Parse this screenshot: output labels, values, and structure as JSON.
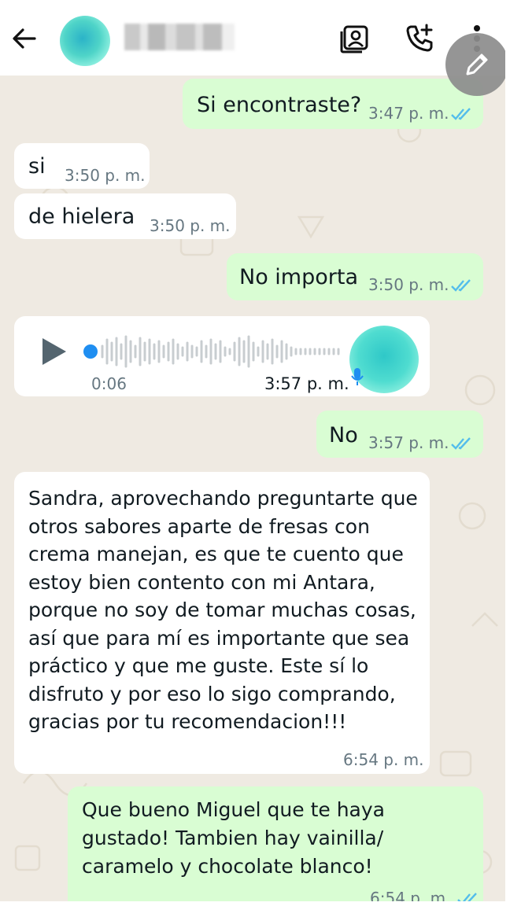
{
  "header": {
    "contact_name": "",
    "icons": [
      "back-arrow-icon",
      "contact-card-icon",
      "add-call-icon",
      "more-options-icon",
      "pencil-icon"
    ]
  },
  "messages": [
    {
      "direction": "out",
      "text": "Si encontraste?",
      "time": "3:47 p. m.",
      "status": "read"
    },
    {
      "direction": "in",
      "text": "si",
      "time": "3:50 p. m."
    },
    {
      "direction": "in",
      "text": "de hielera",
      "time": "3:50 p. m."
    },
    {
      "direction": "out",
      "text": "No importa",
      "time": "3:50 p. m.",
      "status": "read"
    },
    {
      "direction": "in",
      "type": "voice",
      "duration": "0:06",
      "time": "3:57 p. m."
    },
    {
      "direction": "out",
      "text": "No",
      "time": "3:57 p. m.",
      "status": "read"
    },
    {
      "direction": "in",
      "text": "Sandra, aprovechando preguntarte que otros sabores aparte de fresas con crema manejan, es que te cuento que estoy bien contento con mi Antara, porque no soy de tomar muchas cosas, así que para mí es importante que sea práctico y que me guste. Este sí lo disfruto y por eso lo sigo comprando, gracias por tu recomendacion!!!",
      "time": "6:54 p. m."
    },
    {
      "direction": "out",
      "text": "Que bueno Miguel que te haya gustado! Tambien hay vainilla/ caramelo y chocolate blanco!",
      "time": "6:54 p. m.",
      "status": "read"
    }
  ],
  "colors": {
    "chat_background": "#efeae2",
    "outgoing_bubble": "#d9fdd3",
    "incoming_bubble": "#ffffff",
    "read_ticks": "#53bdeb",
    "voice_dot": "#1f8ef1"
  }
}
